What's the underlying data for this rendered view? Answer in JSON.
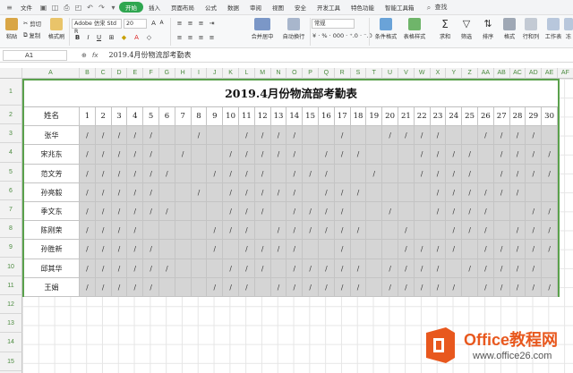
{
  "menubar": {
    "file": "文件",
    "active_tab": "开始",
    "tabs": [
      "插入",
      "页面布局",
      "公式",
      "数据",
      "审阅",
      "视图",
      "安全",
      "开发工具",
      "特色功能",
      "智能工具箱"
    ],
    "search": "查找"
  },
  "ribbon": {
    "cut": "剪切",
    "copy": "复制",
    "paste": "粘贴",
    "format_painter": "格式刷",
    "font_name": "Adobe 仿宋 Std R",
    "font_size": "20",
    "merge_center": "合并居中",
    "wrap_text": "自动换行",
    "number_format": "常规",
    "conditional_format": "条件格式",
    "table_style": "表格样式",
    "sum": "求和",
    "filter": "筛选",
    "sort": "排序",
    "format": "格式",
    "row_col": "行和列",
    "worksheet": "工作表",
    "freeze": "冻"
  },
  "formula_bar": {
    "cell_ref": "A1",
    "fx": "fx",
    "content": "2019.4月份物流部考勤表"
  },
  "columns": [
    "A",
    "B",
    "C",
    "D",
    "E",
    "F",
    "G",
    "H",
    "I",
    "J",
    "K",
    "L",
    "M",
    "N",
    "O",
    "P",
    "Q",
    "R",
    "S",
    "T",
    "U",
    "V",
    "W",
    "X",
    "Y",
    "Z",
    "AA",
    "AB",
    "AC",
    "AD",
    "AE",
    "AF"
  ],
  "rows": [
    "1",
    "2",
    "3",
    "4",
    "5",
    "6",
    "7",
    "8",
    "9",
    "10",
    "11",
    "12",
    "13",
    "14",
    "15",
    "16"
  ],
  "sheet": {
    "title": "2019.4月份物流部考勤表",
    "name_header": "姓名",
    "days": [
      "1",
      "2",
      "3",
      "4",
      "5",
      "6",
      "7",
      "8",
      "9",
      "10",
      "11",
      "12",
      "13",
      "14",
      "15",
      "16",
      "17",
      "18",
      "19",
      "20",
      "21",
      "22",
      "23",
      "24",
      "25",
      "26",
      "27",
      "28",
      "29",
      "30"
    ],
    "employees": [
      {
        "name": "张华",
        "marks": "/////  /  ////  /  ////  ////  /  "
      },
      {
        "name": "宋兆东",
        "marks": "///// /  ///// ///   //// ///// "
      },
      {
        "name": "范文芳",
        "marks": "//////  //// ///  /  //// ////  "
      },
      {
        "name": "孙亮毅",
        "marks": "/////  / ///// ///    //////  / "
      },
      {
        "name": "季文东",
        "marks": "//////   /// ////  /  ////  ////"
      },
      {
        "name": "陈刚荣",
        "marks": "////    /// //////  /  /// ///  "
      },
      {
        "name": "孙胜新",
        "marks": "/////   / ////  /   //// ///// "
      },
      {
        "name": "邱其华",
        "marks": "//////   /// ///// //// ///// "
      },
      {
        "name": "王娟",
        "marks": "/////   /// ////// ///// ////// "
      }
    ]
  },
  "logo": {
    "line1": "Office教程网",
    "line2": "www.office26.com"
  }
}
